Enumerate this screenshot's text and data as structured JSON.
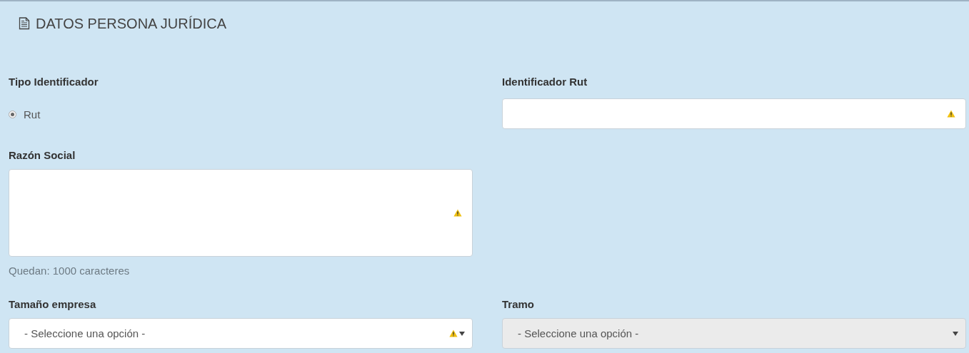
{
  "title": "DATOS PERSONA JURÍDICA",
  "tipo_identificador": {
    "label": "Tipo Identificador",
    "options": [
      {
        "label": "Rut",
        "selected": true
      }
    ]
  },
  "identificador_rut": {
    "label": "Identificador Rut",
    "warning": true
  },
  "razon_social": {
    "label": "Razón Social",
    "warning": true,
    "hint": "Quedan: 1000 caracteres"
  },
  "tamano_empresa": {
    "label": "Tamaño empresa",
    "placeholder": "- Seleccione una opción -",
    "warning": true,
    "disabled": false
  },
  "tramo": {
    "label": "Tramo",
    "placeholder": "- Seleccione una opción -",
    "warning": false,
    "disabled": true
  }
}
